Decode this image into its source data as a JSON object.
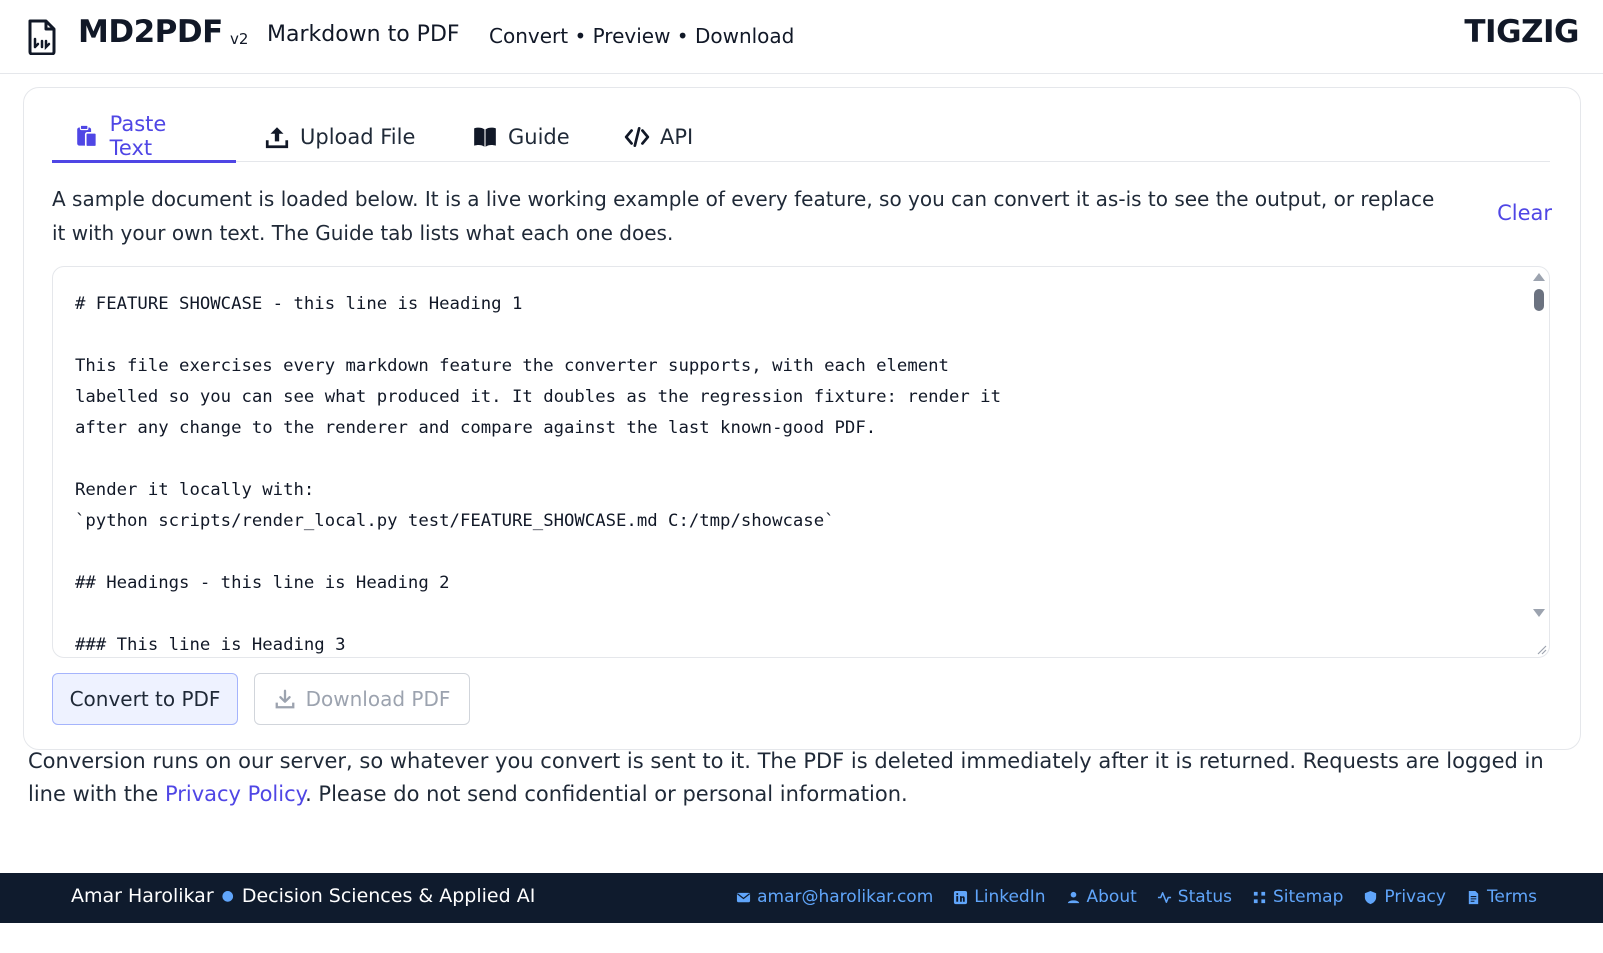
{
  "header": {
    "brand": "MD2PDF",
    "version": "v2",
    "subtitle": "Markdown to PDF",
    "tagline": "Convert • Preview • Download",
    "org": "TIGZIG"
  },
  "tabs": [
    {
      "label": "Paste Text",
      "icon": "clipboard-icon",
      "active": true
    },
    {
      "label": "Upload File",
      "icon": "upload-icon",
      "active": false
    },
    {
      "label": "Guide",
      "icon": "book-icon",
      "active": false
    },
    {
      "label": "API",
      "icon": "code-icon",
      "active": false
    }
  ],
  "intro": "A sample document is loaded below. It is a live working example of every feature, so you can convert it as-is to see the output, or replace it with your own text. The Guide tab lists what each one does.",
  "clear_label": "Clear",
  "editor_content": "# FEATURE SHOWCASE - this line is Heading 1\n\nThis file exercises every markdown feature the converter supports, with each element\nlabelled so you can see what produced it. It doubles as the regression fixture: render it\nafter any change to the renderer and compare against the last known-good PDF.\n\nRender it locally with:\n`python scripts/render_local.py test/FEATURE_SHOWCASE.md C:/tmp/showcase`\n\n## Headings - this line is Heading 2\n\n### This line is Heading 3",
  "buttons": {
    "convert": "Convert to PDF",
    "download": "Download PDF"
  },
  "notice": {
    "before": "Conversion runs on our server, so whatever you convert is sent to it. The PDF is deleted immediately after it is returned. Requests are logged in line with the ",
    "link": "Privacy Policy",
    "after": ". Please do not send confidential or personal information."
  },
  "footer": {
    "name": "Amar Harolikar",
    "role": "Decision Sciences & Applied AI",
    "links": [
      {
        "label": "amar@harolikar.com",
        "icon": "mail-icon"
      },
      {
        "label": "LinkedIn",
        "icon": "linkedin-icon"
      },
      {
        "label": "About",
        "icon": "user-icon"
      },
      {
        "label": "Status",
        "icon": "activity-icon"
      },
      {
        "label": "Sitemap",
        "icon": "grid-icon"
      },
      {
        "label": "Privacy",
        "icon": "shield-icon"
      },
      {
        "label": "Terms",
        "icon": "document-icon"
      }
    ]
  },
  "colors": {
    "accent": "#4f46e5",
    "footer_bg": "#0f1b2d",
    "footer_link": "#60a5fa"
  }
}
